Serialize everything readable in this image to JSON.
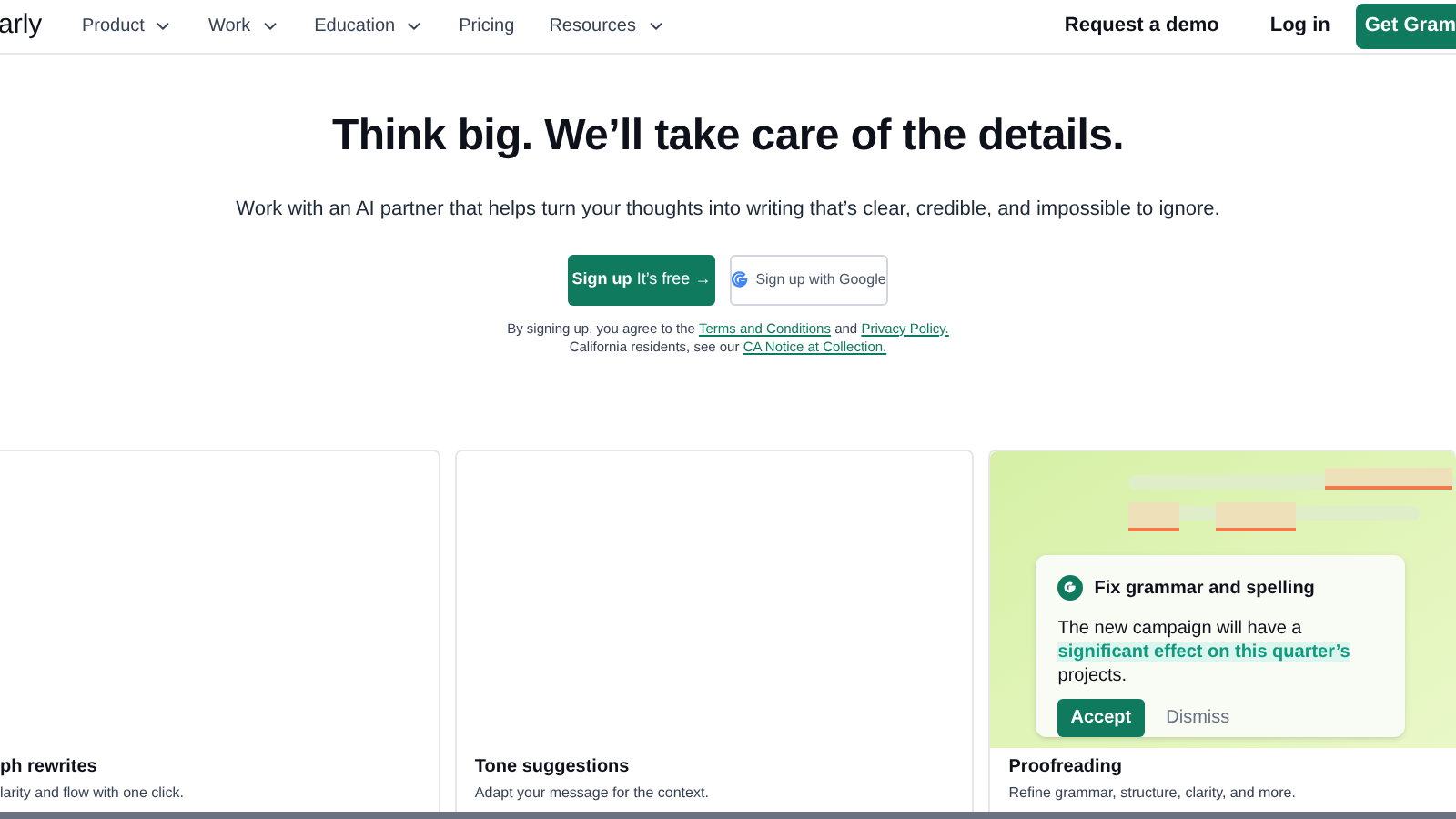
{
  "nav": {
    "logo": "arly",
    "items": [
      {
        "label": "Product",
        "dropdown": true
      },
      {
        "label": "Work",
        "dropdown": true
      },
      {
        "label": "Education",
        "dropdown": true
      },
      {
        "label": "Pricing",
        "dropdown": false
      },
      {
        "label": "Resources",
        "dropdown": true
      }
    ],
    "request_demo": "Request a demo",
    "login": "Log in",
    "cta": "Get Gram"
  },
  "hero": {
    "title": "Think big. We’ll take care of the details.",
    "subtitle": "Work with an AI partner that helps turn your thoughts into writing that’s clear, credible, and impossible to ignore.",
    "signup": {
      "bold": "Sign up",
      "rest": "It’s free",
      "arrow": "→"
    },
    "google": "Sign up with Google",
    "legal_1": "By signing up, you agree to the",
    "terms": "Terms and Conditions",
    "and": "and",
    "privacy": "Privacy Policy.",
    "legal_2": "California residents, see our",
    "ca_notice": "CA Notice at Collection."
  },
  "cards": [
    {
      "title": "ph rewrites",
      "text": "larity and flow with one click."
    },
    {
      "title": "Tone suggestions",
      "text": "Adapt your message for the context."
    },
    {
      "title": "Proofreading",
      "text": "Refine grammar, structure, clarity, and more.",
      "suggestion": {
        "heading": "Fix grammar and spelling",
        "before": "The new campaign will have a",
        "highlight": "significant effect on this quarter’s",
        "after": "projects.",
        "accept": "Accept",
        "dismiss": "Dismiss"
      }
    }
  ]
}
